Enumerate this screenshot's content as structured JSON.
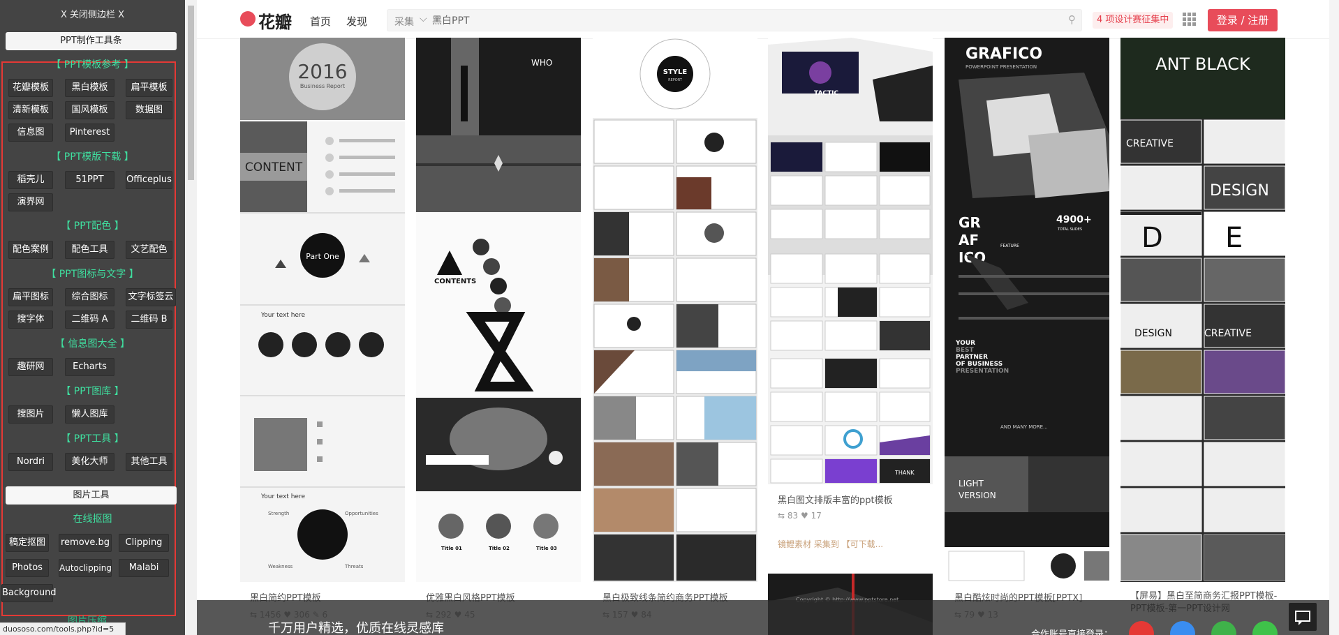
{
  "sidebar": {
    "close_label": "X 关闭侧边栏 X",
    "toolbar_label": "PPT制作工具条",
    "sections": [
      {
        "title": "【 PPT模板参考 】",
        "items": [
          "花瓣模板",
          "黑白模板",
          "扁平模板",
          "清新模板",
          "国风模板",
          "数据图",
          "信息图",
          "Pinterest"
        ]
      },
      {
        "title": "【 PPT模版下载 】",
        "items": [
          "稻壳儿",
          "51PPT",
          "Officeplus",
          "演界网"
        ]
      },
      {
        "title": "【 PPT配色 】",
        "items": [
          "配色案例",
          "配色工具",
          "文艺配色"
        ]
      },
      {
        "title": "【 PPT图标与文字 】",
        "items": [
          "扁平图标",
          "综合图标",
          "文字标签云",
          "搜字体",
          "二维码 A",
          "二维码 B"
        ]
      },
      {
        "title": "【 信息图大全 】",
        "items": [
          "趣研网",
          "Echarts"
        ]
      },
      {
        "title": "【 PPT图库 】",
        "items": [
          "搜图片",
          "懒人图库"
        ]
      },
      {
        "title": "【 PPT工具 】",
        "items": [
          "Nordri",
          "美化大师",
          "其他工具"
        ]
      }
    ],
    "image_tools_label": "图片工具",
    "online_cutout": {
      "title": "在线抠图",
      "items": [
        "稿定抠图",
        "remove.bg",
        "Clipping",
        "Photos",
        "Autoclipping",
        "Malabi",
        "Background"
      ]
    },
    "next_section_partial": "图片压缩",
    "status_url": "duososo.com/tools.php?id=5"
  },
  "header": {
    "logo": "花瓣",
    "nav": [
      "首页",
      "发现"
    ],
    "search_category": "采集",
    "search_value": "黑白PPT",
    "promo": "4 项设计赛征集中",
    "login": "登录 / 注册"
  },
  "pins": [
    {
      "title": "黑白简约PPT模板",
      "repins": "1456",
      "likes": "306",
      "comments": "6",
      "thumb_text": [
        "2016",
        "Business Report",
        "CONTENT",
        "Part One",
        "Your text here",
        "Strength",
        "Opportunities",
        "Weakness",
        "Threats"
      ]
    },
    {
      "title": "优雅黑白风格PPT模板",
      "repins": "292",
      "likes": "45",
      "thumb_text": [
        "WHO",
        "CONTENTS",
        "Title 01",
        "Title 02",
        "Title 03"
      ]
    },
    {
      "title": "黑白极致线条简约商务PPT模板",
      "repins": "157",
      "likes": "84",
      "thumb_text": [
        "STYLE",
        "REPORT"
      ]
    },
    {
      "title": "黑白图文排版丰富的ppt模板",
      "repins": "83",
      "likes": "17",
      "source": "镜鲤素材 采集到 【可下载...",
      "thumb_text": [
        "TACTIC",
        "THANK"
      ],
      "watermark": "Copyright © http://www.pptstore.net"
    },
    {
      "title": "黑白酷炫时尚的PPT模板[PPTX]",
      "repins": "79",
      "likes": "13",
      "thumb_text": [
        "GRAFICO",
        "POWERPOINT PRESENTATION",
        "GR",
        "AF",
        "ICO",
        "4900+",
        "TOTAL SLIDES",
        "LIGHT",
        "VERSION",
        "FEATURE",
        "YOUR",
        "BEST",
        "PARTNER",
        "OF BUSINESS",
        "PRESENTATION",
        "AND MANY MORE..."
      ]
    },
    {
      "title": "【屏易】黑白至简商务汇报PPT模板-PPT模板-第一PPT设计网",
      "thumb_text": [
        "ANT BLACK",
        "CREATIVE",
        "DESIGN",
        "D",
        "E",
        "CREATIVE",
        "DESIGN"
      ]
    }
  ],
  "banner": {
    "text": "千万用户精选，优质在线灵感库",
    "right_text": "合作账号直接登录："
  },
  "colors": {
    "sidebar_bg": "#444444",
    "section_title": "#3fe0a0",
    "highlight_border": "#e53935",
    "brand_red": "#e84c5a"
  }
}
